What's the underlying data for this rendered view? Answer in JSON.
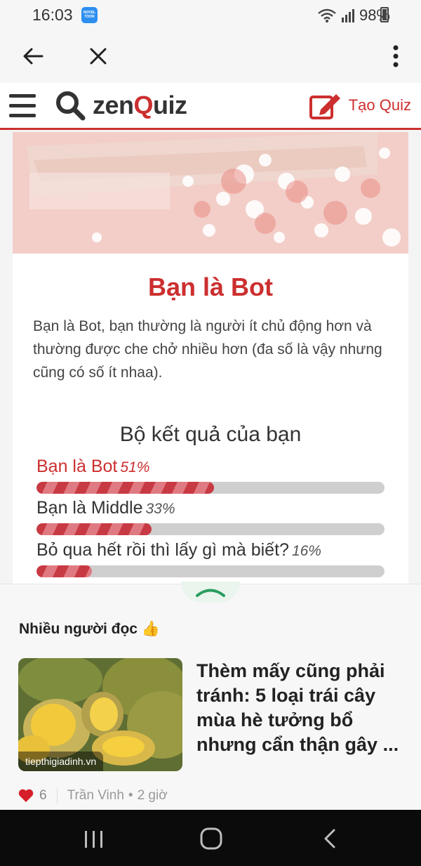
{
  "status_bar": {
    "time": "16:03",
    "app_badge": "NOVEL TOON",
    "battery": "98%"
  },
  "browser_bar": {
    "back_icon": "arrow-left-icon",
    "close_icon": "close-icon",
    "menu_icon": "more-vert-icon"
  },
  "site_header": {
    "logo_prefix": "zen",
    "logo_q": "Q",
    "logo_suffix": "uiz",
    "create_label": "Tạo Quiz"
  },
  "result": {
    "title": "Bạn là Bot",
    "description": "Bạn là Bot, bạn thường là người ít chủ động hơn và thường được che chở nhiều hơn (đa số là vậy nhưng cũng có số ít nhaa).",
    "heading": "Bộ kết quả của bạn",
    "items": [
      {
        "label": "Bạn là Bot",
        "percent_text": "51%",
        "value": 51
      },
      {
        "label": "Bạn là Middle",
        "percent_text": "33%",
        "value": 33
      },
      {
        "label": "Bỏ qua hết rồi thì lấy gì mà biết?",
        "percent_text": "16%",
        "value": 16
      }
    ]
  },
  "reading_sheet": {
    "title": "Nhiều người đọc",
    "title_emoji": "👍",
    "article": {
      "source": "tiepthigiadinh.vn",
      "headline": "Thèm mấy cũng phải tránh: 5 loại trái cây mùa hè tưởng bổ nhưng cẩn thận gây ...",
      "likes": "6",
      "author": "Trần Vinh",
      "time": "2 giờ"
    }
  },
  "colors": {
    "brand_red": "#cc2f2f",
    "navbar": "#0b0b0b"
  }
}
